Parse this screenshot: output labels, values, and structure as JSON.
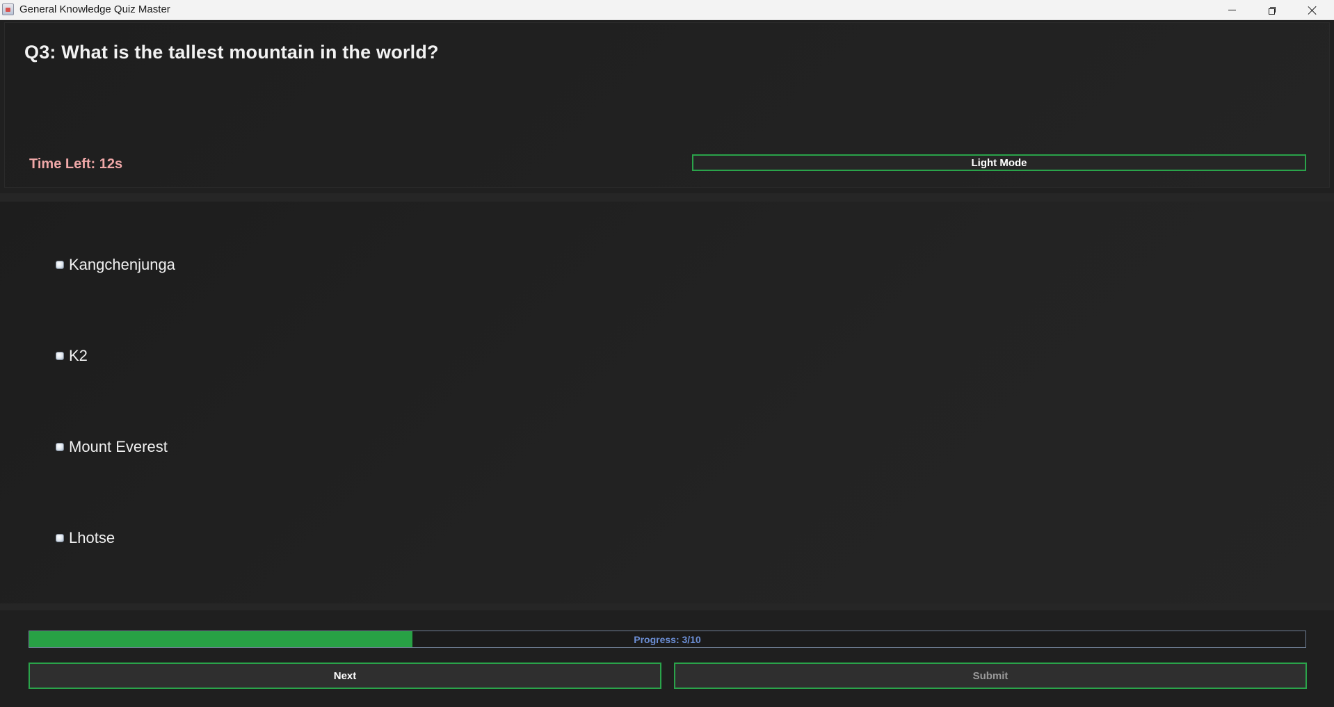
{
  "window": {
    "title": "General Knowledge Quiz Master"
  },
  "header": {
    "question": "Q3: What is the tallest mountain in the world?",
    "timer": "Time Left: 12s",
    "mode_button": "Light Mode"
  },
  "options": [
    {
      "label": "Kangchenjunga",
      "selected": false
    },
    {
      "label": "K2",
      "selected": false
    },
    {
      "label": "Mount Everest",
      "selected": false
    },
    {
      "label": "Lhotse",
      "selected": false
    }
  ],
  "footer": {
    "progress_text": "Progress: 3/10",
    "progress_value": 0.3,
    "next_label": "Next",
    "submit_label": "Submit",
    "submit_enabled": false
  },
  "colors": {
    "accent": "#2aa34a",
    "progress_fill": "#28a145",
    "timer_text": "#f0a8a8",
    "progress_text": "#6c8fd6",
    "background": "#202020"
  },
  "icons": [
    "app-icon",
    "minimize-icon",
    "maximize-icon",
    "close-icon",
    "radio-icon"
  ]
}
